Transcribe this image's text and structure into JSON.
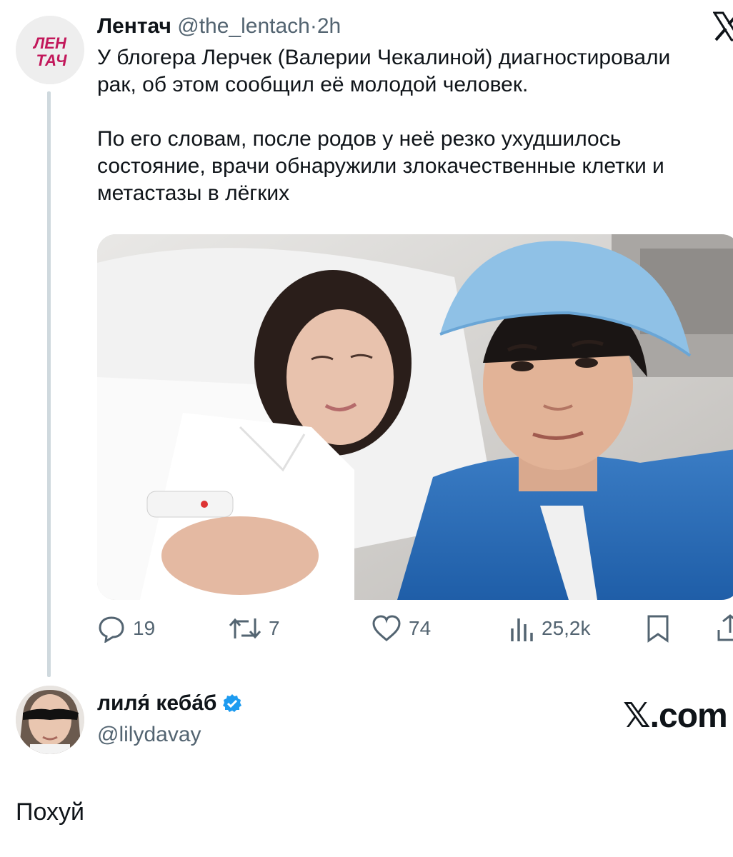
{
  "quoted_tweet": {
    "author_name": "Лентач",
    "handle": "@the_lentach",
    "separator": "·",
    "time": "2h",
    "avatar_logo": "ЛЕН ТАЧ",
    "text": "У блогера Лерчек (Валерии Чекалиной) диагностировали\nрак, об этом сообщил её молодой человек.\n\nПо его словам, после родов у неё резко ухудшилось\nсостояние, врачи обнаружили злокачественные клетки и\nметастазы в лёгких",
    "image": {
      "alt": "photo",
      "icon": "photo-icon"
    },
    "actions": {
      "replies": "19",
      "retweets": "7",
      "likes": "74",
      "views": "25,2k"
    },
    "icons": [
      "reply-icon",
      "retweet-icon",
      "like-icon",
      "views-icon",
      "bookmark-icon",
      "share-icon",
      "x-logo-icon"
    ]
  },
  "reply_author": {
    "name": "лиля́ кеба́б",
    "handle": "@lilydavay",
    "verified": true,
    "verified_color": "#1d9bf0"
  },
  "watermark": "𝕏.com",
  "reply_text": "Похуй",
  "colors": {
    "text": "#0f1419",
    "secondary": "#536471",
    "lentach_brand": "#c2185b",
    "thread_line": "#cfd9de"
  }
}
